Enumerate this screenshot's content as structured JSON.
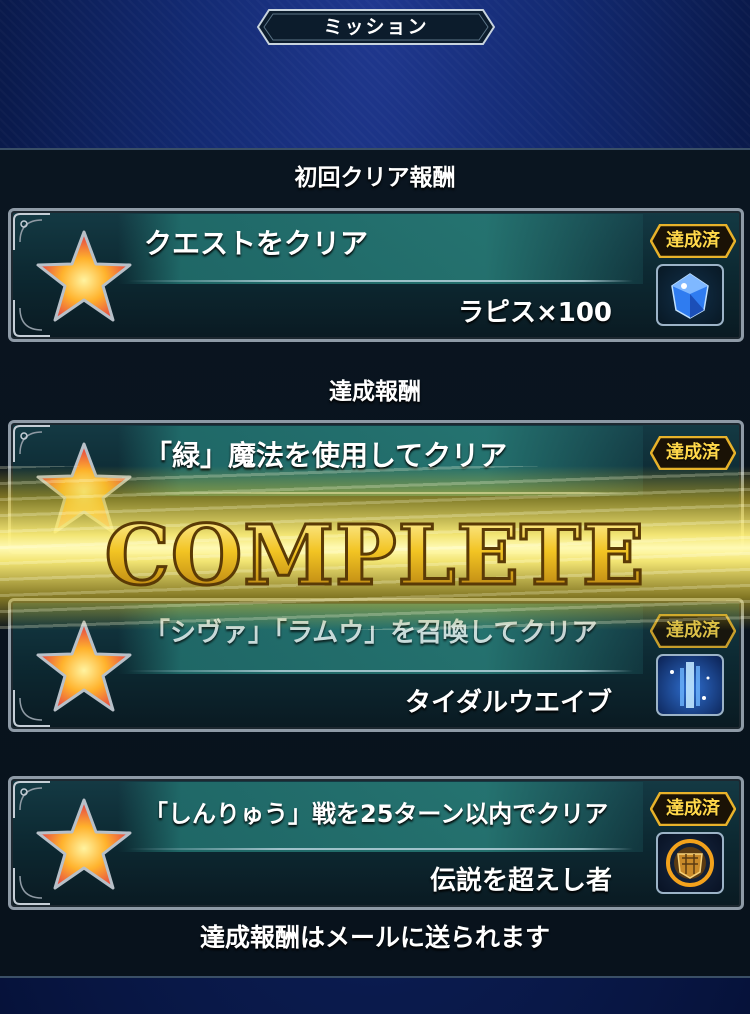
{
  "screen_title": "ミッション",
  "section_first": "初回クリア報酬",
  "section_achievement": "達成報酬",
  "badge_label": "達成済",
  "banner_text": "COMPLETE",
  "footer_note": "達成報酬はメールに送られます",
  "missions": [
    {
      "title": "クエストをクリア",
      "reward": "ラピス×100",
      "icon": "lapis-crystal-icon",
      "status": "達成済"
    },
    {
      "title": "「緑」魔法を使用してクリア",
      "reward": "",
      "icon": "",
      "status": "達成済"
    },
    {
      "title": "「シヴァ」「ラムウ」を召喚してクリア",
      "reward": "タイダルウエイブ",
      "icon": "tidal-wave-icon",
      "status": "達成済"
    },
    {
      "title": "「しんりゅう」戦を25ターン以内でクリア",
      "reward": "伝説を超えし者",
      "icon": "legend-emblem-icon",
      "status": "達成済"
    }
  ],
  "colors": {
    "background": "#132a72",
    "panel": "#0a1520",
    "card_teal": "#216e6c",
    "badge_text": "#ffd84a",
    "banner_gold": "#f2c423"
  }
}
